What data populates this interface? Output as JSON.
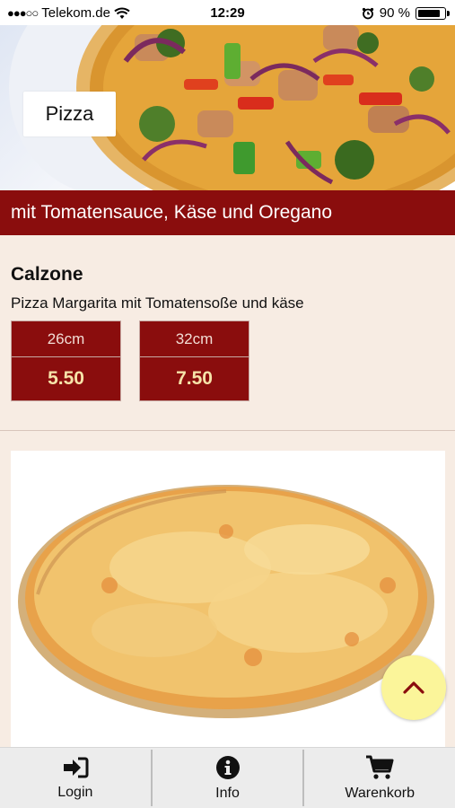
{
  "status_bar": {
    "signal": "●●●○○",
    "carrier": "Telekom.de",
    "time": "12:29",
    "battery": "90 %"
  },
  "hero": {
    "category": "Pizza"
  },
  "category_subtitle": "mit Tomatensauce, Käse und Oregano",
  "product": {
    "name": "Calzone",
    "description": "Pizza Margarita mit Tomatensoße und käse",
    "sizes": [
      {
        "label": "26cm",
        "price": "5.50"
      },
      {
        "label": "32cm",
        "price": "7.50"
      }
    ]
  },
  "tabbar": {
    "login": "Login",
    "info": "Info",
    "cart": "Warenkorb"
  },
  "colors": {
    "brand_red": "#8a0d0d",
    "price_yellow": "#f6e3a9",
    "fab_yellow": "#fbf59a",
    "background": "#f7ece3"
  },
  "icons": {
    "login": "sign-in-icon",
    "info": "info-circle-icon",
    "cart": "shopping-cart-icon",
    "fab": "chevron-up-icon"
  }
}
